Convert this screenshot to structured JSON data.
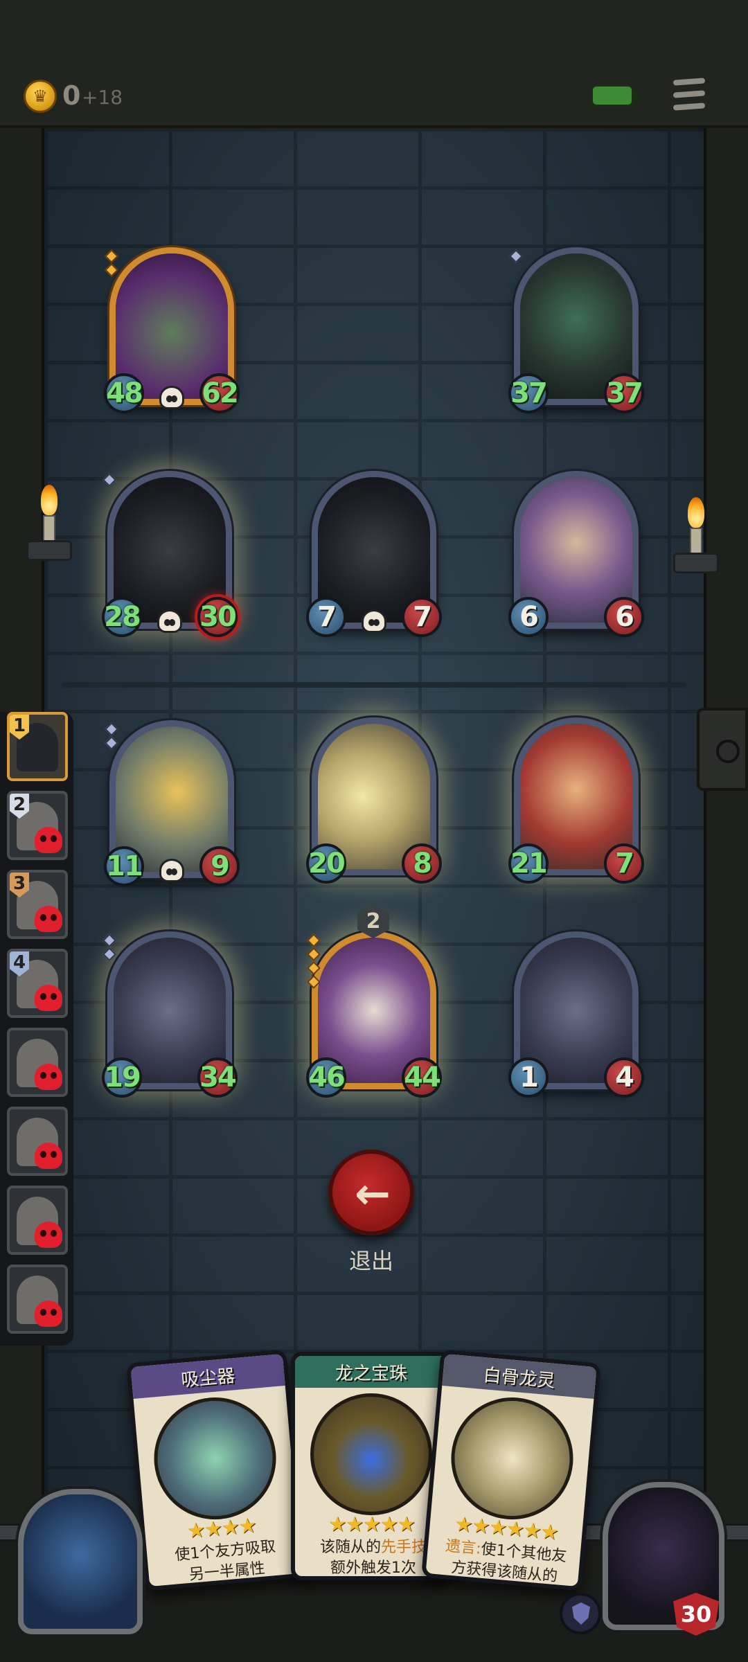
{
  "header": {
    "gold": "0",
    "gold_income": "+18",
    "coin_icon": "crown-coin-icon",
    "battery_icon": "battery-icon",
    "menu_icon": "hamburger-menu-icon"
  },
  "board": {
    "enemy_row1": [
      {
        "name": "mimic-chest",
        "attack": "48",
        "health": "62",
        "deathrattle": true
      },
      {
        "name": "reaper",
        "attack": "37",
        "health": "37",
        "deathrattle": false
      }
    ],
    "enemy_row2": [
      {
        "name": "dark-knight",
        "attack": "28",
        "health": "30",
        "deathrattle": true
      },
      {
        "name": "dark-knight-small",
        "attack": "7",
        "health": "7",
        "deathrattle": true
      },
      {
        "name": "sorceress",
        "attack": "6",
        "health": "6",
        "deathrattle": false
      }
    ],
    "player_row1": [
      {
        "name": "golden-dragon",
        "attack": "11",
        "health": "9",
        "deathrattle": true
      },
      {
        "name": "holy-shield-dwarf",
        "attack": "20",
        "health": "8",
        "deathrattle": false
      },
      {
        "name": "red-warrior",
        "attack": "21",
        "health": "7",
        "deathrattle": false
      }
    ],
    "player_row2": [
      {
        "name": "rat-bandit",
        "attack": "19",
        "health": "34",
        "deathrattle": false
      },
      {
        "name": "old-wizard-dwarf",
        "attack": "46",
        "health": "44",
        "deathrattle": false,
        "level": "2"
      },
      {
        "name": "rat-bandit-small",
        "attack": "1",
        "health": "4",
        "deathrattle": false
      }
    ]
  },
  "lineup": {
    "ranks": [
      "1",
      "2",
      "3",
      "4"
    ]
  },
  "exit": {
    "label": "退出",
    "icon": "arrow-left-icon"
  },
  "hand": [
    {
      "title": "吸尘器",
      "stars": "★★★★",
      "line1": "使1个友方吸取",
      "line2": "另一半属性",
      "color": "#5a4a86"
    },
    {
      "title": "龙之宝珠",
      "stars": "★★★★★",
      "line1_pre": "该随从的",
      "line1_kw": "先手技",
      "line2": "额外触发1次",
      "color": "#2f6e5c"
    },
    {
      "title": "白骨龙灵",
      "stars": "★★★★★★",
      "line1_kw": "遗言:",
      "line1_post": "使1个其他友",
      "line2": "方获得该随从的",
      "color": "#55576a"
    }
  ],
  "hero": {
    "health": "30",
    "armor_icon": "shield-icon"
  },
  "colors": {
    "buffed_stat": "#7fe07a",
    "gold_frame": "#d18b2f",
    "silver_frame": "#4d5670",
    "exit_red": "#c52b2b"
  }
}
